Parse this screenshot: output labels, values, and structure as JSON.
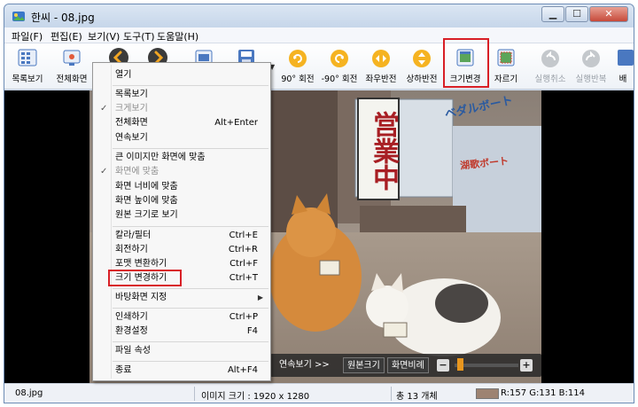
{
  "window": {
    "title": "한씨 - 08.jpg",
    "controls": {
      "minimize": "▁",
      "maximize": "☐",
      "close": "✕"
    }
  },
  "menubar": {
    "items": [
      "파일(F)",
      "편집(E)",
      "보기(V)",
      "도구(T)",
      "도움말(H)"
    ]
  },
  "toolbar": {
    "buttons": [
      {
        "label": "목록보기",
        "icon": "list-view-icon",
        "enabled": true
      },
      {
        "label": "전체화면",
        "icon": "fullscreen-icon",
        "enabled": true
      },
      {
        "label": "",
        "icon": "prev-arrow-icon",
        "enabled": true
      },
      {
        "label": "",
        "icon": "next-arrow-icon",
        "enabled": true
      },
      {
        "label": "",
        "icon": "thumbnail-view-icon",
        "enabled": true
      },
      {
        "label": "",
        "icon": "save-icon",
        "enabled": true
      },
      {
        "label": "90° 회전",
        "icon": "rotate-cw-icon",
        "enabled": true
      },
      {
        "label": "-90° 회전",
        "icon": "rotate-ccw-icon",
        "enabled": true
      },
      {
        "label": "좌우반전",
        "icon": "flip-horizontal-icon",
        "enabled": true
      },
      {
        "label": "상하반전",
        "icon": "flip-vertical-icon",
        "enabled": true
      },
      {
        "label": "크기변경",
        "icon": "resize-icon",
        "enabled": true,
        "highlighted": true
      },
      {
        "label": "자르기",
        "icon": "crop-icon",
        "enabled": true
      },
      {
        "label": "실행취소",
        "icon": "undo-icon",
        "enabled": false
      },
      {
        "label": "실행반복",
        "icon": "redo-icon",
        "enabled": false
      },
      {
        "label": "배",
        "icon": "more-icon",
        "enabled": true
      }
    ]
  },
  "context_menu": {
    "items": [
      {
        "label": "열기",
        "shortcut": "",
        "checked": false,
        "disabled": false
      },
      {
        "label": "목록보기",
        "shortcut": "",
        "checked": false,
        "disabled": false
      },
      {
        "label": "크게보기",
        "shortcut": "",
        "checked": true,
        "disabled": true
      },
      {
        "label": "전체화면",
        "shortcut": "Alt+Enter",
        "checked": false,
        "disabled": false
      },
      {
        "label": "연속보기",
        "shortcut": "",
        "checked": false,
        "disabled": false
      },
      {
        "label": "큰 이미지만 화면에 맞춤",
        "shortcut": "",
        "checked": false,
        "disabled": false
      },
      {
        "label": "화면에 맞춤",
        "shortcut": "",
        "checked": true,
        "disabled": true
      },
      {
        "label": "화면 너비에 맞춤",
        "shortcut": "",
        "checked": false,
        "disabled": false
      },
      {
        "label": "화면 높이에 맞춤",
        "shortcut": "",
        "checked": false,
        "disabled": false
      },
      {
        "label": "원본 크기로 보기",
        "shortcut": "",
        "checked": false,
        "disabled": false
      },
      {
        "label": "칼라/필터",
        "shortcut": "Ctrl+E",
        "checked": false,
        "disabled": false
      },
      {
        "label": "회전하기",
        "shortcut": "Ctrl+R",
        "checked": false,
        "disabled": false
      },
      {
        "label": "포맷 변환하기",
        "shortcut": "Ctrl+F",
        "checked": false,
        "disabled": false
      },
      {
        "label": "크기 변경하기",
        "shortcut": "Ctrl+T",
        "checked": false,
        "disabled": false,
        "highlighted": true
      },
      {
        "label": "바탕화면 지정",
        "shortcut": "",
        "checked": false,
        "disabled": false,
        "submenu": true
      },
      {
        "label": "인쇄하기",
        "shortcut": "Ctrl+P",
        "checked": false,
        "disabled": false
      },
      {
        "label": "환경설정",
        "shortcut": "F4",
        "checked": false,
        "disabled": false
      },
      {
        "label": "파일 속성",
        "shortcut": "",
        "checked": false,
        "disabled": false
      },
      {
        "label": "종료",
        "shortcut": "Alt+F4",
        "checked": false,
        "disabled": false
      }
    ]
  },
  "viewer_controls": {
    "slideshow": "연속보기 >>",
    "original_size": "원본크기",
    "fit_screen": "화면비례",
    "zoom_minus": "−",
    "zoom_plus": "+"
  },
  "photo_signs": {
    "vertical_sign": "営業中",
    "shop_sign_line1": "ベダルボート",
    "shop_sign_line2": "湖歌ボート"
  },
  "statusbar": {
    "filename": "08.jpg",
    "image_size": "이미지 크기 : 1920 x 1280",
    "count": "총 13 개체",
    "rgb": "R:157 G:131 B:114",
    "swatch_color": "#9d8372"
  },
  "colors": {
    "highlight": "#d81f26",
    "accent_orange": "#e8961e"
  }
}
